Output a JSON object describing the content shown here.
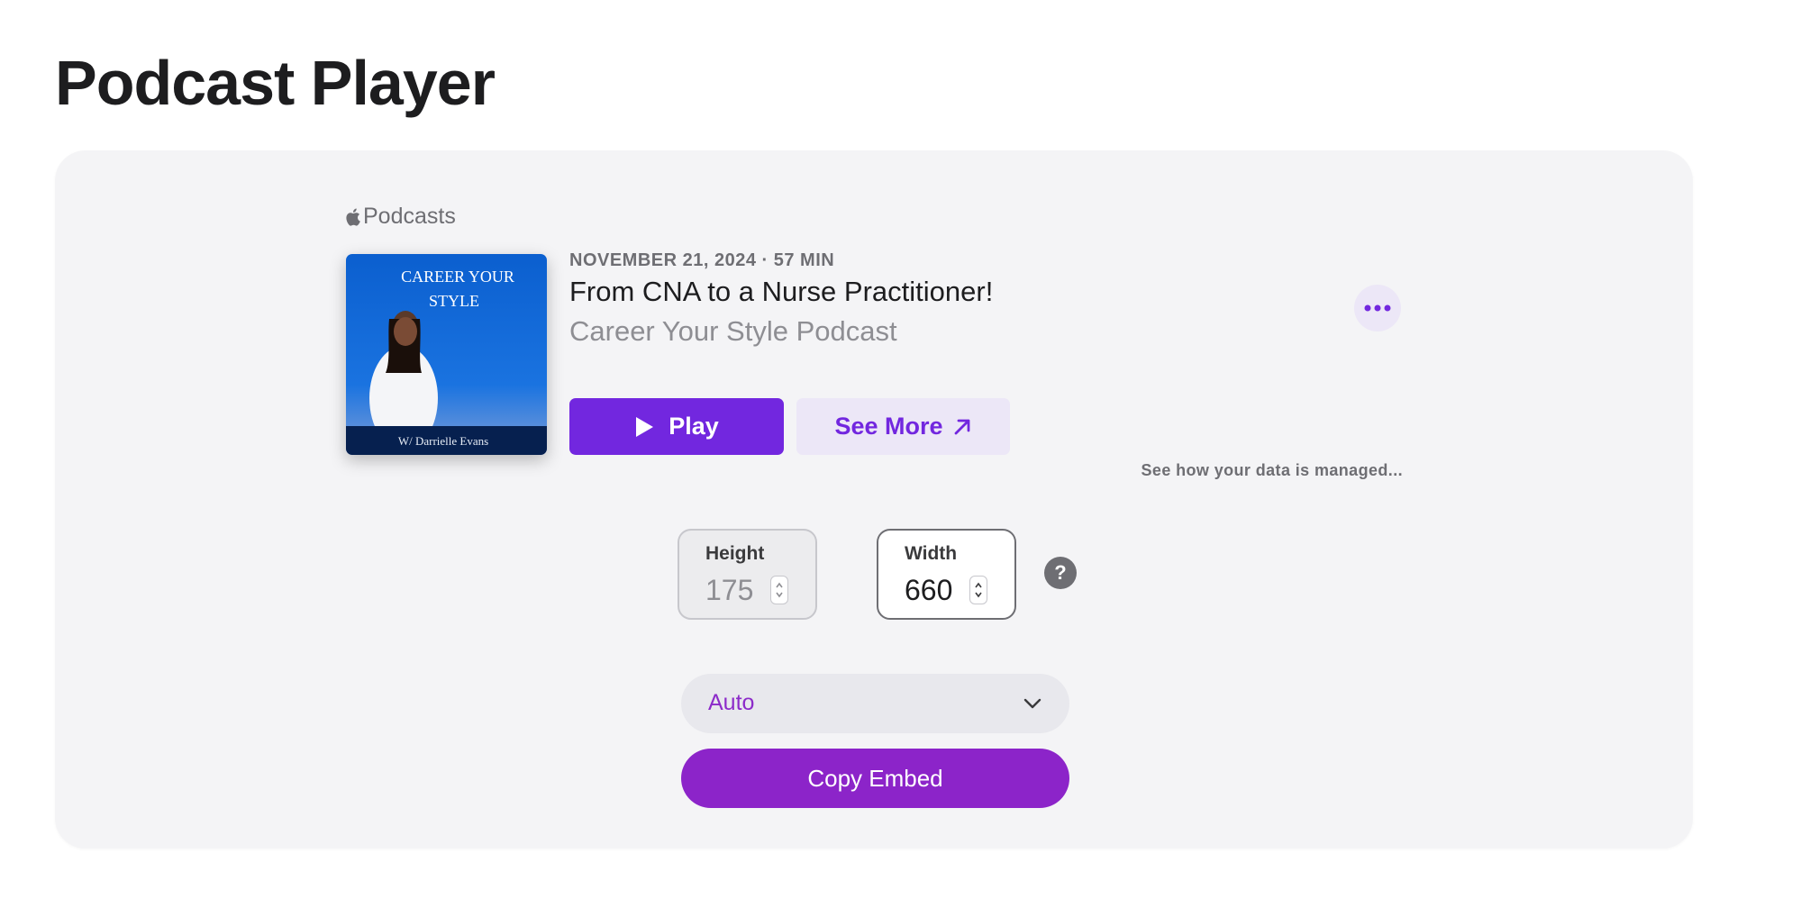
{
  "page": {
    "title": "Podcast Player"
  },
  "embed": {
    "brand_label": "Podcasts",
    "artwork": {
      "title_line1": "CAREER YOUR",
      "title_line2": "STYLE",
      "byline": "W/ Darrielle Evans"
    },
    "meta": "NOVEMBER 21, 2024 · 57 MIN",
    "episode_title": "From CNA to a Nurse Practitioner!",
    "show_name": "Career Your Style Podcast",
    "play_label": "Play",
    "see_more_label": "See More",
    "data_link": "See how your data is managed...",
    "accent_color": "#7227df"
  },
  "controls": {
    "height_label": "Height",
    "height_value": "175",
    "width_label": "Width",
    "width_value": "660",
    "help_label": "?",
    "theme_value": "Auto",
    "copy_label": "Copy Embed",
    "copy_color": "#8c24c9"
  }
}
